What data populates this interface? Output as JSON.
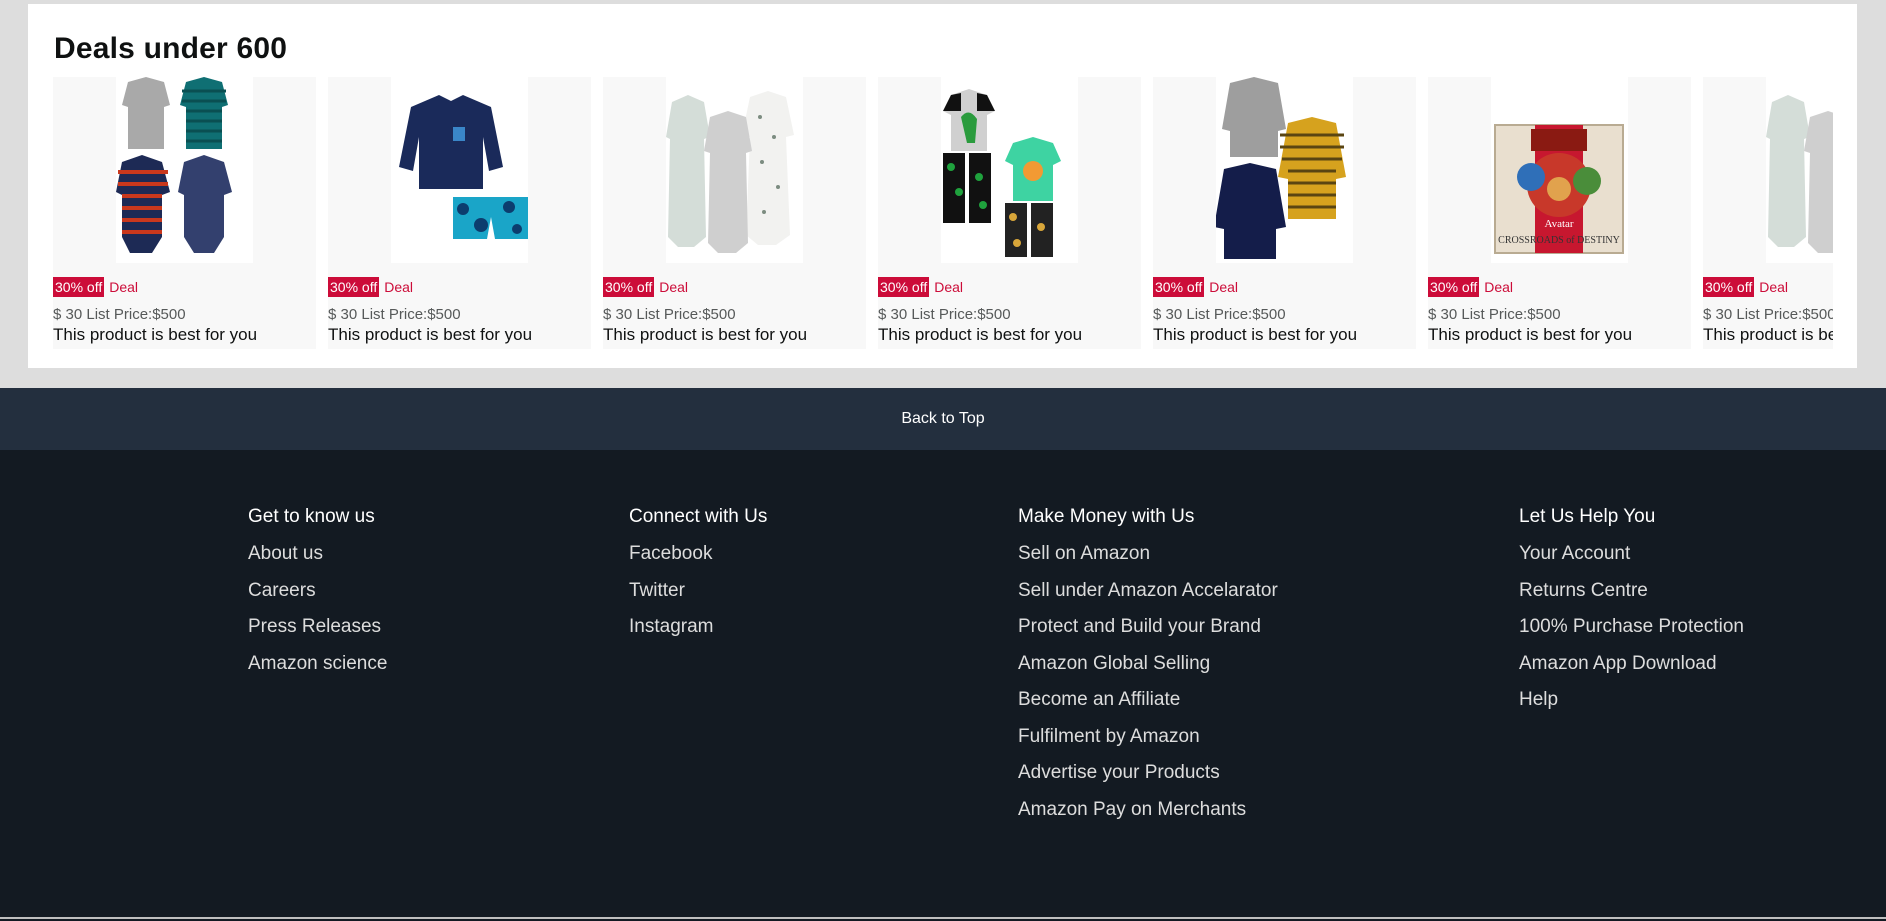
{
  "deals": {
    "title": "Deals under 600",
    "products": [
      {
        "image": "baby-bodysuits-4pack",
        "badge": "30% off",
        "deal_label": "Deal",
        "price_line": "$ 30 List Price:$500",
        "description": "This product is best for you"
      },
      {
        "image": "rashguard-swim-set",
        "badge": "30% off",
        "deal_label": "Deal",
        "price_line": "$ 30 List Price:$500",
        "description": "This product is best for you"
      },
      {
        "image": "sleep-gowns-3pack",
        "badge": "30% off",
        "deal_label": "Deal",
        "price_line": "$ 30 List Price:$500",
        "description": "This product is best for you"
      },
      {
        "image": "dino-pajama-set",
        "badge": "30% off",
        "deal_label": "Deal",
        "price_line": "$ 30 List Price:$500",
        "description": "This product is best for you"
      },
      {
        "image": "knit-pullovers-3pack",
        "badge": "30% off",
        "deal_label": "Deal",
        "price_line": "$ 30 List Price:$500",
        "description": "This product is best for you"
      },
      {
        "image": "board-game-box",
        "badge": "30% off",
        "deal_label": "Deal",
        "price_line": "$ 30 List Price:$500",
        "description": "This product is best for you"
      },
      {
        "image": "sleep-gowns-partial",
        "badge": "30% off",
        "deal_label": "Deal",
        "price_line": "$ 30 List Price:$500",
        "description": "This product is best for you"
      }
    ]
  },
  "back_to_top": "Back to Top",
  "footer": {
    "columns": [
      {
        "heading": "Get to know us",
        "links": [
          "About us",
          "Careers",
          "Press Releases",
          "Amazon science"
        ]
      },
      {
        "heading": "Connect with Us",
        "links": [
          "Facebook",
          "Twitter",
          "Instagram"
        ]
      },
      {
        "heading": "Make Money with Us",
        "links": [
          "Sell on Amazon",
          "Sell under Amazon Accelarator",
          "Protect and Build your Brand",
          "Amazon Global Selling",
          "Become an Affiliate",
          "Fulfilment by Amazon",
          "Advertise your Products",
          "Amazon Pay on Merchants"
        ]
      },
      {
        "heading": "Let Us Help You",
        "links": [
          "Your Account",
          "Returns Centre",
          "100% Purchase Protection",
          "Amazon App Download",
          "Help"
        ]
      }
    ]
  },
  "colors": {
    "deal_red": "#cc0c39",
    "back_to_top_bg": "#232f3e",
    "footer_bg": "#131a22"
  }
}
